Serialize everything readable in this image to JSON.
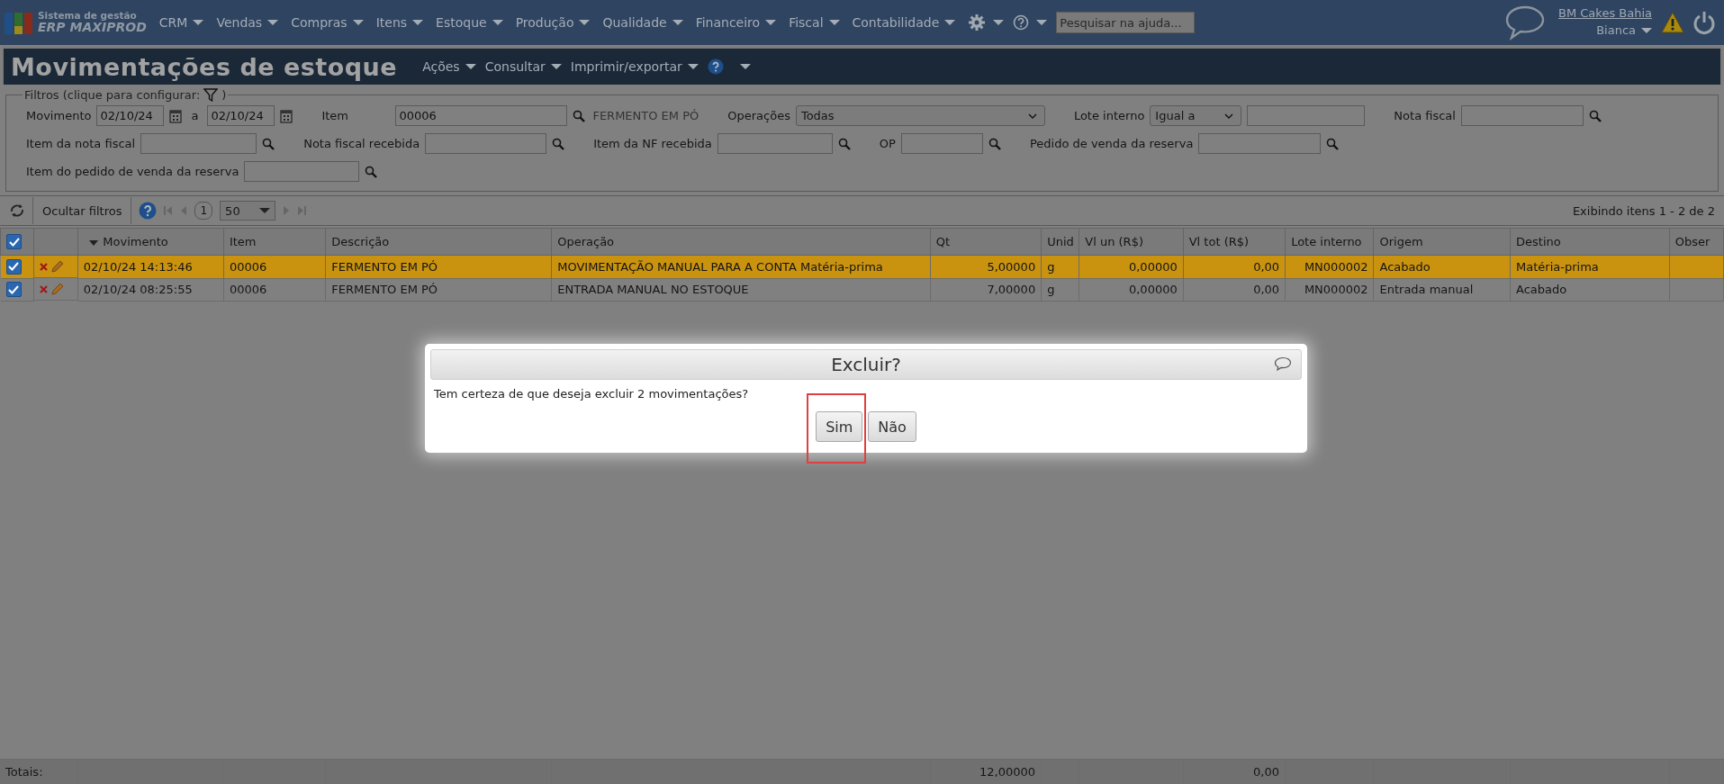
{
  "app": {
    "logo_top": "Sistema de gestão",
    "logo_bottom": "ERP MAXIPROD",
    "menu": [
      "CRM",
      "Vendas",
      "Compras",
      "Itens",
      "Estoque",
      "Produção",
      "Qualidade",
      "Financeiro",
      "Fiscal",
      "Contabilidade"
    ],
    "help_search": {
      "placeholder": "Pesquisar na ajuda..."
    },
    "company": "BM Cakes Bahia",
    "user": "Bianca"
  },
  "page": {
    "title": "Movimentações de estoque",
    "menu": [
      "Ações",
      "Consultar",
      "Imprimir/exportar"
    ]
  },
  "filters": {
    "legend": "Filtros (clique para configurar:",
    "legend_end": ")",
    "rows": [
      {
        "fields": [
          {
            "kind": "date-range",
            "label": "Movimento",
            "from": "02/10/24",
            "separator": "a",
            "to": "02/10/24"
          },
          {
            "kind": "lookup",
            "label": "Item",
            "value": "00006",
            "description": "FERMENTO EM PÓ"
          },
          {
            "kind": "select",
            "label": "Operações",
            "value": "Todas"
          },
          {
            "kind": "select-input",
            "label": "Lote interno",
            "value": "Igual a"
          },
          {
            "kind": "lookup",
            "label": "Nota fiscal"
          }
        ]
      },
      {
        "fields": [
          {
            "kind": "lookup",
            "label": "Item da nota fiscal"
          },
          {
            "kind": "lookup",
            "label": "Nota fiscal recebida"
          },
          {
            "kind": "lookup",
            "label": "Item da NF recebida"
          },
          {
            "kind": "lookup",
            "label": "OP"
          },
          {
            "kind": "lookup",
            "label": "Pedido de venda da reserva"
          }
        ]
      },
      {
        "fields": [
          {
            "kind": "lookup",
            "label": "Item do pedido de venda da reserva"
          }
        ]
      }
    ]
  },
  "toolbar": {
    "hide_filters": "Ocultar filtros",
    "page": "1",
    "page_size": "50",
    "summary": "Exibindo itens 1 - 2 de 2"
  },
  "table": {
    "all_checked": true,
    "columns": [
      {
        "label": "Movimento",
        "sorted": true
      },
      {
        "label": "Item",
        "sorted": false
      },
      {
        "label": "Descrição",
        "sorted": false
      },
      {
        "label": "Operação",
        "sorted": false
      },
      {
        "label": "Qt",
        "sorted": false
      },
      {
        "label": "Unid",
        "sorted": false
      },
      {
        "label": "Vl un (R$)",
        "sorted": false
      },
      {
        "label": "Vl tot (R$)",
        "sorted": false
      },
      {
        "label": "Lote interno",
        "sorted": false
      },
      {
        "label": "Origem",
        "sorted": false
      },
      {
        "label": "Destino",
        "sorted": false
      },
      {
        "label": "Obser",
        "sorted": false
      }
    ],
    "rows": [
      {
        "checked": true,
        "selected": true,
        "cells": [
          "02/10/24 14:13:46",
          "00006",
          "FERMENTO EM PÓ",
          "MOVIMENTAÇÃO MANUAL PARA A CONTA Matéria-prima",
          "5,00000",
          "g",
          "0,00000",
          "0,00",
          "MN000002",
          "Acabado",
          "Matéria-prima"
        ]
      },
      {
        "checked": true,
        "selected": false,
        "cells": [
          "02/10/24 08:25:55",
          "00006",
          "FERMENTO EM PÓ",
          "ENTRADA MANUAL NO ESTOQUE",
          "7,00000",
          "g",
          "0,00000",
          "0,00",
          "MN000002",
          "Entrada manual",
          "Acabado"
        ]
      }
    ],
    "totals": {
      "label": "Totais:",
      "qt": "12,00000",
      "vl_tot": "0,00"
    }
  },
  "dialog": {
    "title": "Excluir?",
    "message": "Tem certeza de que deseja excluir 2 movimentações?",
    "buttons": [
      {
        "label": "Sim",
        "highlighted": true
      },
      {
        "label": "Não",
        "highlighted": false
      }
    ]
  }
}
